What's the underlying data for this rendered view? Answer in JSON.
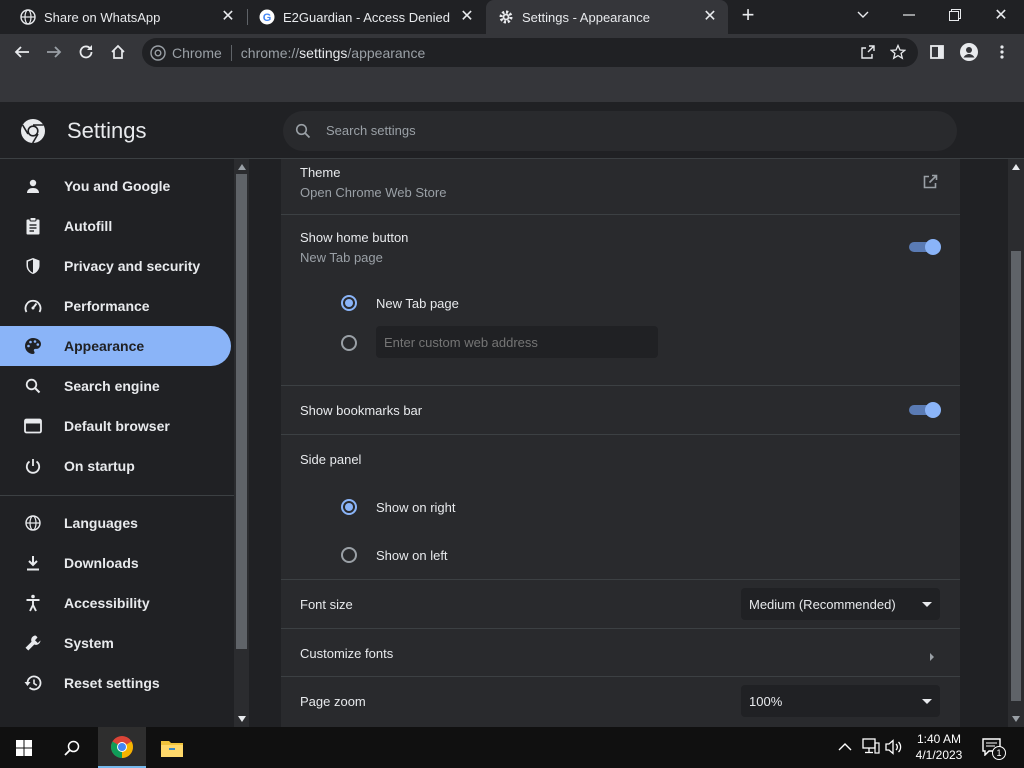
{
  "tabs": [
    {
      "title": "Share on WhatsApp",
      "icon": "globe-icon"
    },
    {
      "title": "E2Guardian - Access Denied",
      "icon": "google-icon"
    },
    {
      "title": "Settings - Appearance",
      "icon": "gear-icon",
      "active": true
    }
  ],
  "omnibox": {
    "scheme_label": "Chrome",
    "url_prefix": "chrome://",
    "url_host": "settings",
    "url_path": "/appearance"
  },
  "settings": {
    "title": "Settings",
    "search_placeholder": "Search settings",
    "nav": [
      {
        "label": "You and Google",
        "icon": "person-icon"
      },
      {
        "label": "Autofill",
        "icon": "clipboard-icon"
      },
      {
        "label": "Privacy and security",
        "icon": "shield-icon"
      },
      {
        "label": "Performance",
        "icon": "speedometer-icon"
      },
      {
        "label": "Appearance",
        "icon": "palette-icon",
        "active": true
      },
      {
        "label": "Search engine",
        "icon": "search-icon"
      },
      {
        "label": "Default browser",
        "icon": "browser-window-icon"
      },
      {
        "label": "On startup",
        "icon": "power-icon"
      },
      {
        "label": "Languages",
        "icon": "globe-icon"
      },
      {
        "label": "Downloads",
        "icon": "download-icon"
      },
      {
        "label": "Accessibility",
        "icon": "accessibility-icon"
      },
      {
        "label": "System",
        "icon": "wrench-icon"
      },
      {
        "label": "Reset settings",
        "icon": "reset-history-icon"
      }
    ]
  },
  "appearance": {
    "theme": {
      "title": "Theme",
      "subtitle": "Open Chrome Web Store"
    },
    "home_button": {
      "title": "Show home button",
      "subtitle": "New Tab page",
      "enabled": true,
      "options": [
        {
          "label": "New Tab page",
          "selected": true
        },
        {
          "label": "",
          "selected": false
        }
      ],
      "custom_placeholder": "Enter custom web address"
    },
    "bookmarks_bar": {
      "title": "Show bookmarks bar",
      "enabled": true
    },
    "side_panel": {
      "title": "Side panel",
      "options": [
        {
          "label": "Show on right",
          "selected": true
        },
        {
          "label": "Show on left",
          "selected": false
        }
      ]
    },
    "font_size": {
      "title": "Font size",
      "value": "Medium (Recommended)"
    },
    "customize_fonts": {
      "title": "Customize fonts"
    },
    "page_zoom": {
      "title": "Page zoom",
      "value": "100%"
    }
  },
  "taskbar": {
    "time": "1:40 AM",
    "date": "4/1/2023",
    "notification_count": "1"
  },
  "colors": {
    "accent": "#8ab4f8",
    "background": "#202124",
    "card": "#292a2d"
  }
}
